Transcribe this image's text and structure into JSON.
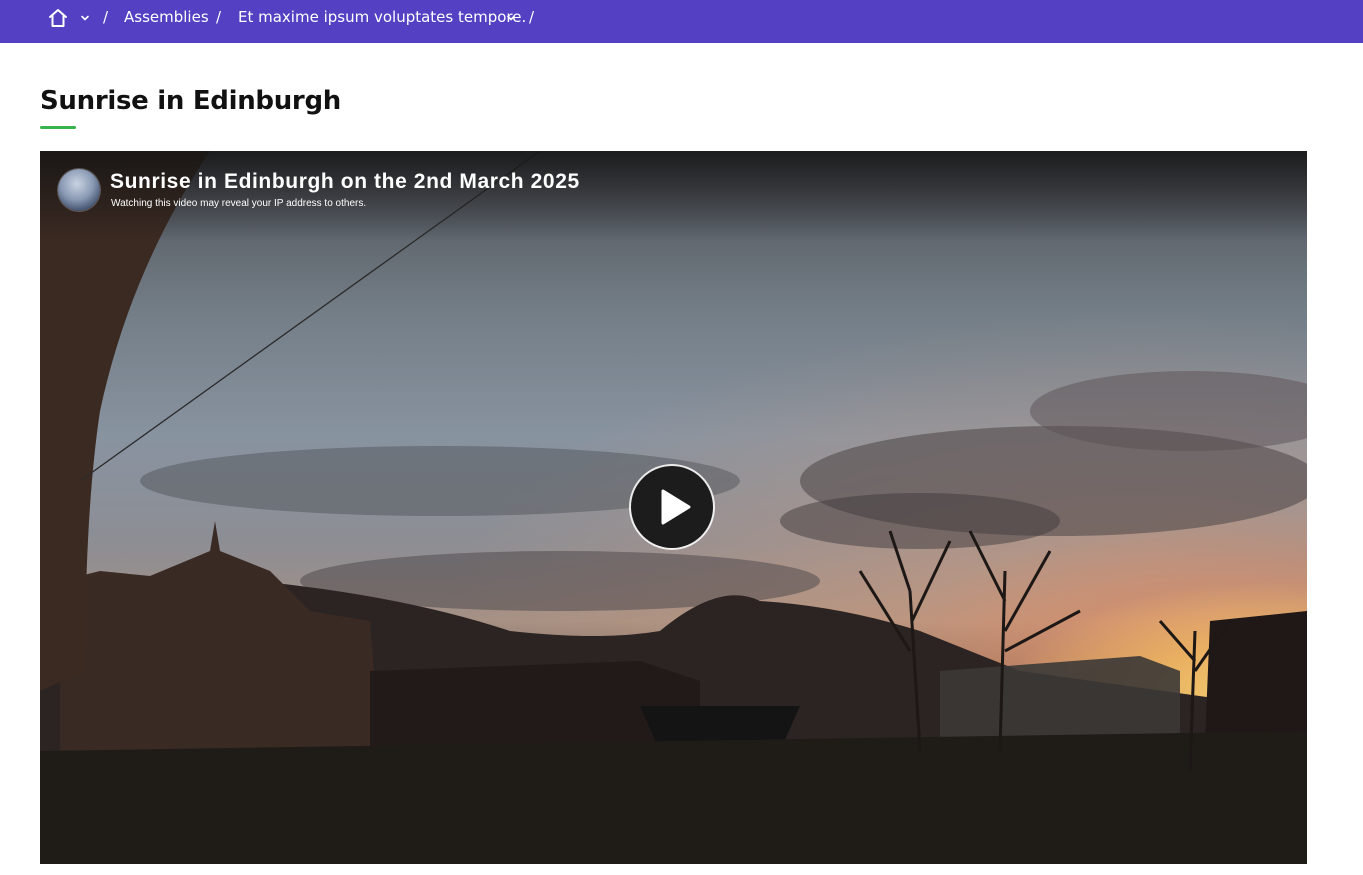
{
  "breadcrumb": {
    "separator": "/",
    "items": [
      {
        "label": "Assemblies"
      },
      {
        "label": "Et maxime ipsum voluptates tempore."
      }
    ]
  },
  "page": {
    "title": "Sunrise in Edinburgh"
  },
  "video": {
    "title": "Sunrise in Edinburgh on the 2nd March 2025",
    "notice": "Watching this video may reveal your IP address to others."
  },
  "colors": {
    "topbar": "#5340c2",
    "title_accent": "#36b34a"
  },
  "icons": {
    "home": "home-icon",
    "chevron": "chevron-down-icon",
    "play": "play-icon"
  }
}
